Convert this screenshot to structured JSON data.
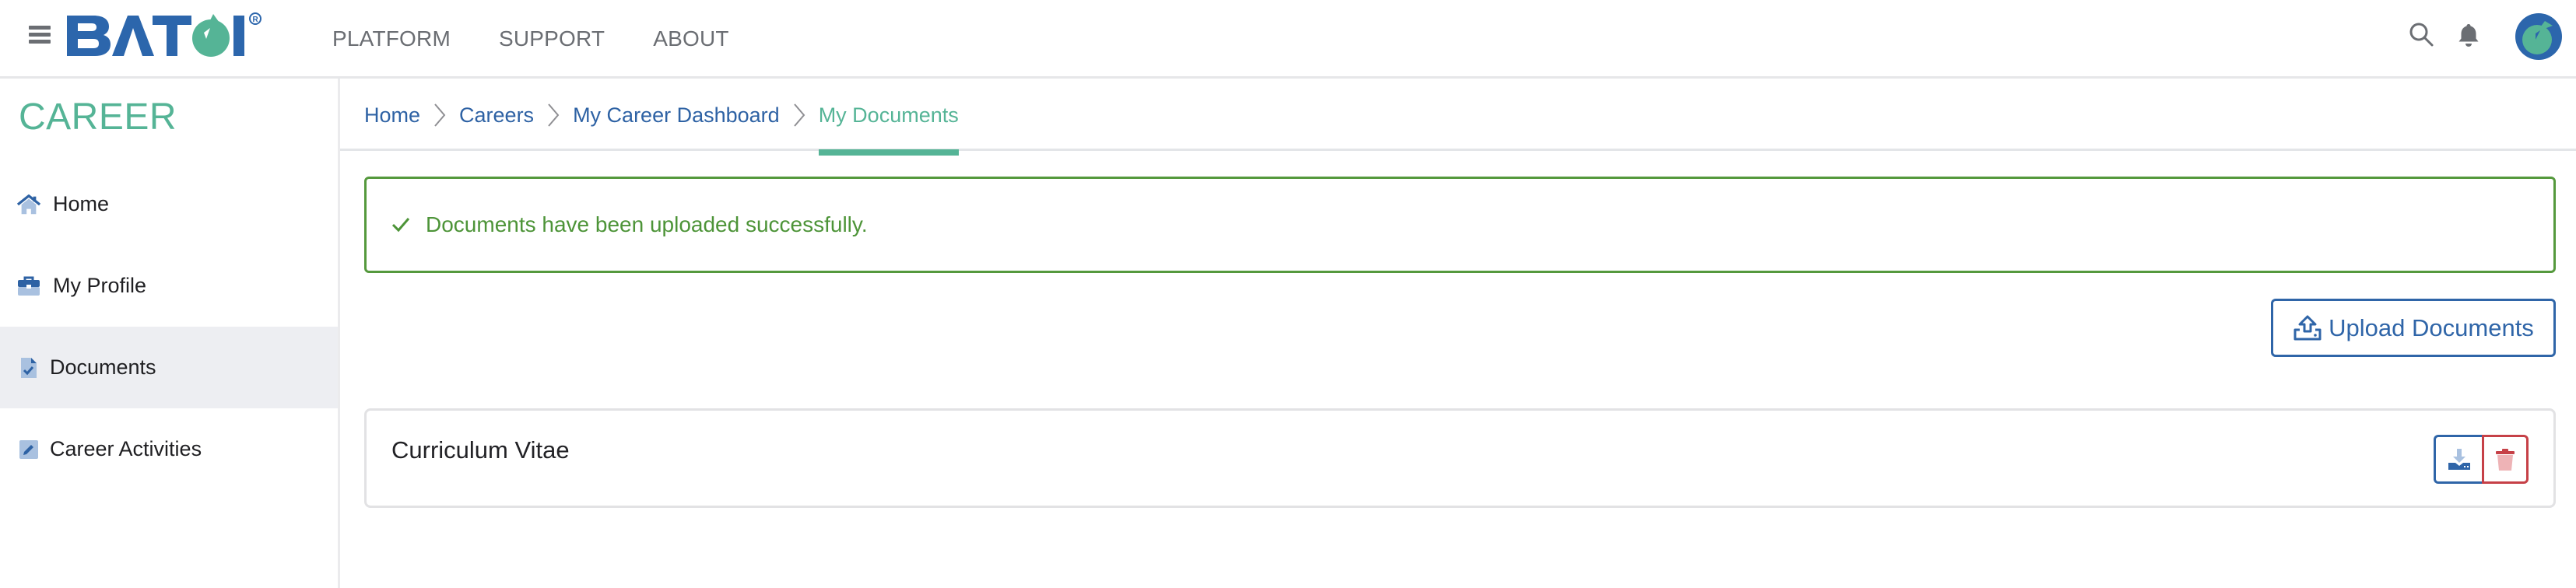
{
  "header": {
    "logo_text": "BATOI",
    "logo_registered": "®",
    "nav": [
      {
        "label": "PLATFORM"
      },
      {
        "label": "SUPPORT"
      },
      {
        "label": "ABOUT"
      }
    ],
    "icons": {
      "menu": "hamburger-menu-icon",
      "search": "search-icon",
      "notifications": "bell-icon",
      "avatar": "user-avatar"
    }
  },
  "sidebar": {
    "title": "CAREER",
    "items": [
      {
        "label": "Home",
        "icon": "home-icon",
        "active": false
      },
      {
        "label": "My Profile",
        "icon": "briefcase-icon",
        "active": false
      },
      {
        "label": "Documents",
        "icon": "document-check-icon",
        "active": true
      },
      {
        "label": "Career Activities",
        "icon": "pencil-icon",
        "active": false
      }
    ]
  },
  "breadcrumb": {
    "items": [
      {
        "label": "Home"
      },
      {
        "label": "Careers"
      },
      {
        "label": "My Career Dashboard"
      },
      {
        "label": "My Documents",
        "current": true
      }
    ]
  },
  "alert": {
    "type": "success",
    "message": "Documents have been uploaded successfully."
  },
  "actions": {
    "upload_label": "Upload Documents"
  },
  "documents": [
    {
      "name": "Curriculum Vitae",
      "actions": [
        "download",
        "delete"
      ]
    }
  ],
  "colors": {
    "brand_blue": "#2e62a4",
    "brand_green": "#55b496",
    "success": "#4d9438",
    "danger": "#c64047"
  }
}
